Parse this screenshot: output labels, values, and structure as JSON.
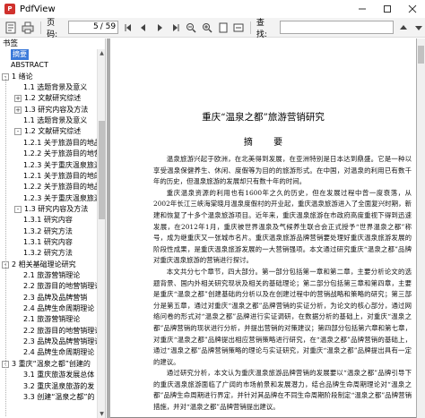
{
  "window": {
    "title": "PdfView",
    "icon_name": "pdf-app-icon",
    "controls": [
      "minimize-icon",
      "maximize-icon",
      "close-icon"
    ]
  },
  "toolbar": {
    "page_label": "页码:",
    "page_current": "5",
    "page_total": "/ 59",
    "search_label": "查找:",
    "search_value": "",
    "icons": [
      "bookmark-icon",
      "print-icon",
      "first-page-icon",
      "prev-page-icon",
      "next-page-icon",
      "last-page-icon",
      "zoom-out-icon",
      "zoom-in-icon",
      "fit-page-icon",
      "fit-width-icon",
      "search-up-icon",
      "search-down-icon"
    ]
  },
  "sidebar": {
    "header": "书签",
    "items": [
      {
        "label": "摘要",
        "selected": true
      },
      {
        "label": "ABSTRACT"
      },
      {
        "label": "1 绪论",
        "expander": "-"
      },
      {
        "label": "1.1 选题背景及意义"
      },
      {
        "label": "1.2 文献研究综述",
        "expander": "+"
      },
      {
        "label": "1.3 研究内容及方法",
        "expander": "+"
      },
      {
        "label": "1.1 选题背景及意义"
      },
      {
        "label": "1.2 文献研究综述",
        "expander": "-"
      },
      {
        "label": "1.2.1 关于旅游目的地品"
      },
      {
        "label": "1.2.2 关于旅游目的地营"
      },
      {
        "label": "1.2.3 关于重庆温泉旅游"
      },
      {
        "label": "1.2.1 关于旅游目的地的"
      },
      {
        "label": "1.2.2 关于旅游目的地品牌"
      },
      {
        "label": "1.2.3 关于重庆温泉旅游营"
      },
      {
        "label": "1.3 研究内容及方法",
        "expander": "-"
      },
      {
        "label": "1.3.1 研究内容"
      },
      {
        "label": "1.3.2 研究方法"
      },
      {
        "label": "1.3.1 研究内容"
      },
      {
        "label": "1.3.2 研究方法"
      },
      {
        "label": "2 相关基础理论研究",
        "expander": "-"
      },
      {
        "label": "2.1 旅游营销理论"
      },
      {
        "label": "2.2 旅游目的地营销理论"
      },
      {
        "label": "2.3 品牌及品牌营销"
      },
      {
        "label": "2.4 品牌生命周期理论"
      },
      {
        "label": "2.1 旅游营销理论"
      },
      {
        "label": "2.2 旅游目的地营销理论"
      },
      {
        "label": "2.3 品牌及品牌营销理论"
      },
      {
        "label": "2.4 品牌生命周期理论"
      },
      {
        "label": "3 重庆“温泉之都”创建的",
        "expander": "-"
      },
      {
        "label": "3.1 重庆旅游发展总体"
      },
      {
        "label": "3.2 重庆温泉旅游的发"
      },
      {
        "label": "3.3 创建“温泉之都”的"
      }
    ]
  },
  "document": {
    "title": "重庆“温泉之都”旅游营销研究",
    "heading": "摘 要",
    "paragraphs": [
      "温泉旅游兴起于欧洲，在北美得到发展，在亚洲特别是日本达到鼎盛。它是一种以享受温泉保健养生、休闲、度假等为目的的旅游形式。在中国，对温泉的利用已有数千年的历史，但温泉旅游的发展却只有数十年的时间。",
      "重庆温泉资源的利用也有1600年之久的历史，但在发展过程中曾一度衰落，从2002年长江三峡海棠晓月温泉度假村的开业起，重庆温泉旅游进入了全面复兴时期，新建和恢复了十多个温泉旅游项目。近年来，重庆温泉旅游在市政府高度重视下得到迅速发展，在2012年1月，重庆被世界温泉及气候养生联合会正式授予“世界温泉之都”称号，成为继重庆又一张城市名片。重庆温泉旅游品牌营销要处理好重庆温泉旅游发展的阶段性成果，是重庆温泉旅游发展的一大营销强项。本文通过研究重庆“温泉之都”品牌对重庆温泉旅游的营销进行探讨。",
      "本文共分七个章节，四大部分。第一部分包括第一章和第二章，主要分析论文的选题背景、国内外相关研究现状及相关的基础理论；第二部分包括第三章和第四章，主要是重庆“温泉之都”创建基础的分析以及在创建过程中的营销战略和策略的研究；第三部分是第五章，通过对重庆“温泉之都”品牌营销的实证分析，为论文的核心部分，通过网络问卷的形式对“温泉之都”品牌进行实证调研，在数据分析的基础上，对重庆“温泉之都”品牌营销的现状进行分析，并提出营销的对策建议；第四部分包括第六章和第七章，对重庆“温泉之都”品牌提出相应营销策略进行研究，在“温泉之都”品牌营销的基础上，通过“温泉之都”品牌营销策略的理论与实证研究，对重庆“温泉之都”品牌提出具有一定的建议。",
      "通过研究分析，本文认为重庆温泉旅游品牌营销的发展要以“温泉之都”品牌引导下的重庆温泉旅游面临了广阔的市场前景和发展潜力，结合品牌生命周期理论对“温泉之都”品牌生命周期进行界定，并针对其品牌在不同生命周期阶段制定“温泉之都”品牌营销措施，并对“温泉之都”品牌营销提出建议。"
    ]
  }
}
